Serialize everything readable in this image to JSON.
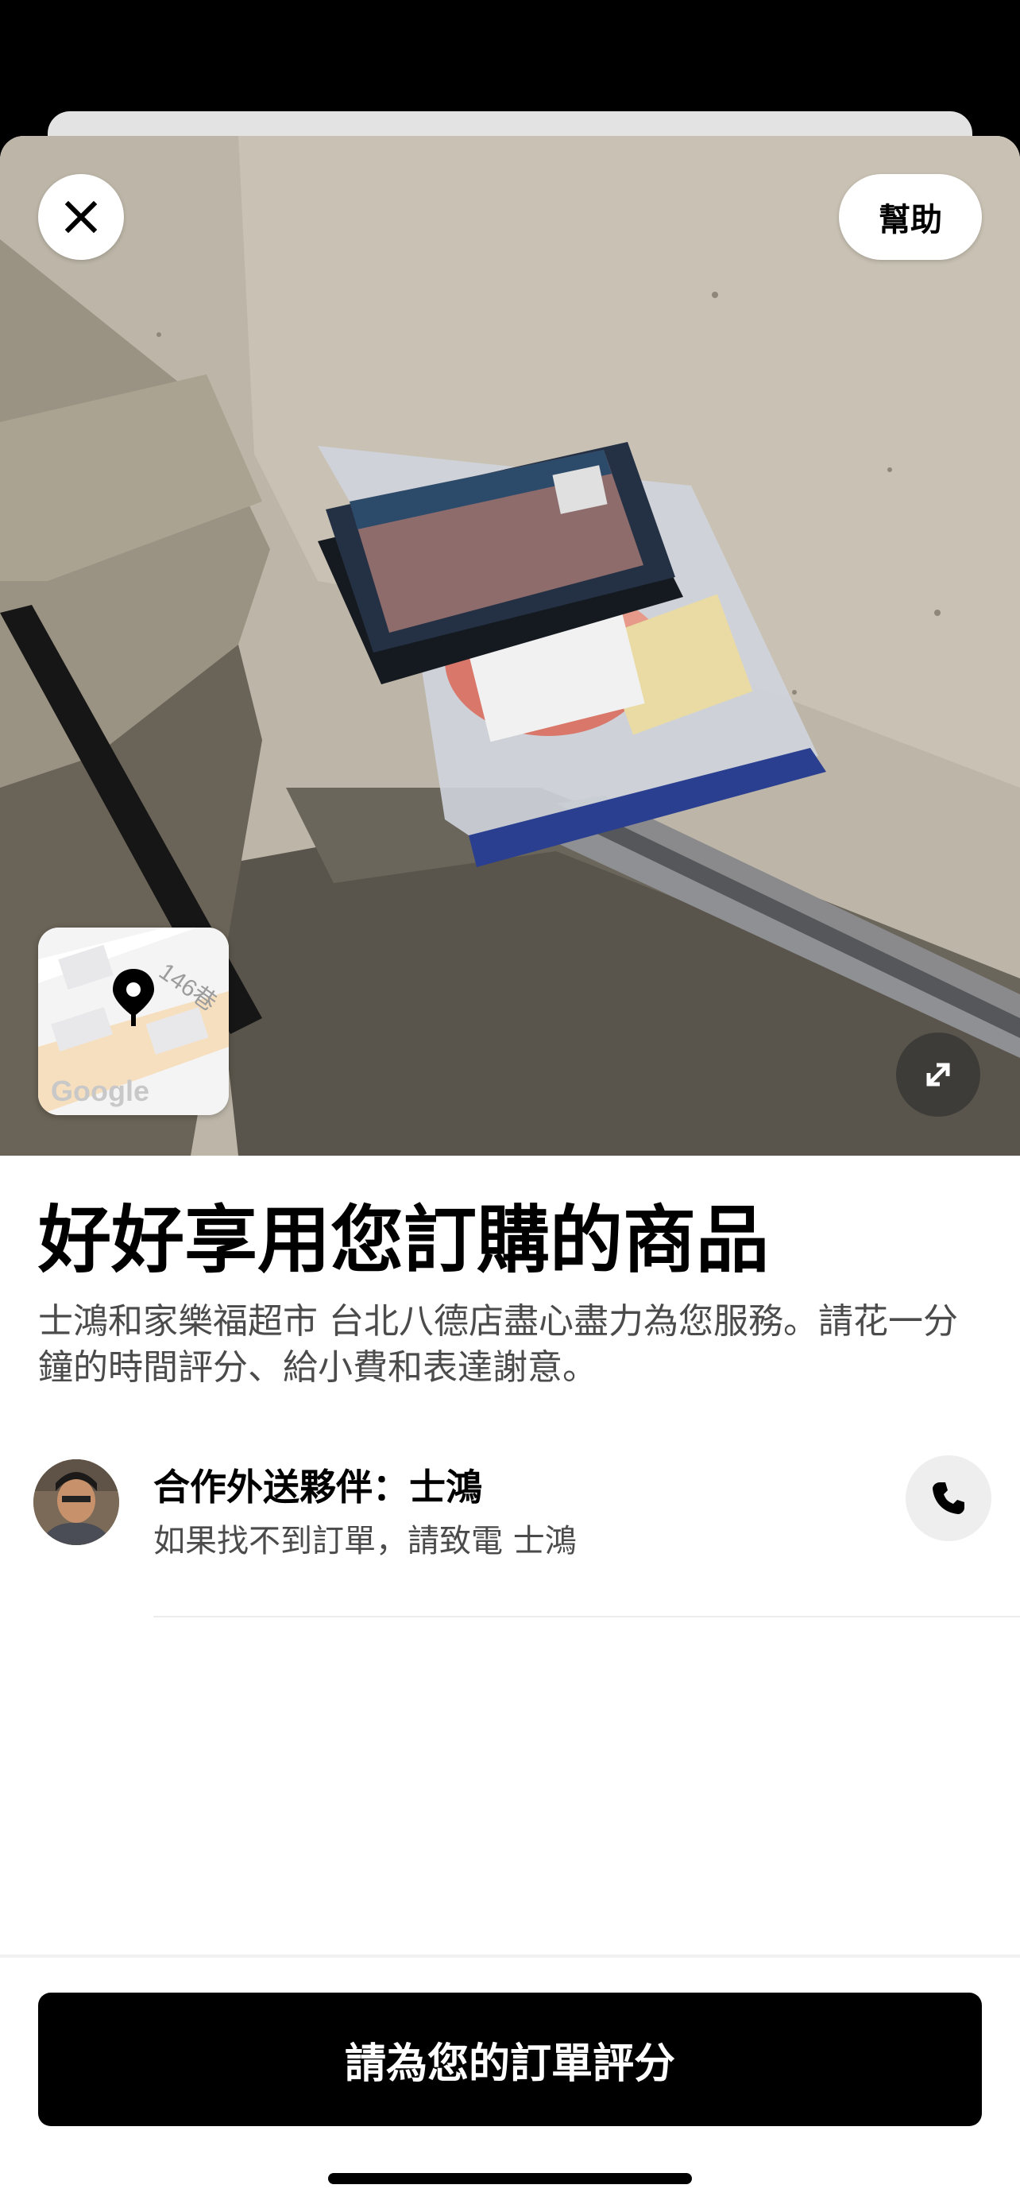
{
  "header": {
    "help_label": "幫助"
  },
  "photo": {
    "map_watermark": "Google",
    "map_street_fragment": "146巷"
  },
  "main": {
    "title": "好好享用您訂購的商品",
    "description": "士鴻和家樂福超市 台北八德店盡心盡力為您服務。請花一分鐘的時間評分、給小費和表達謝意。"
  },
  "courier": {
    "name": "合作外送夥伴：士鴻",
    "hint": "如果找不到訂單，請致電 士鴻"
  },
  "footer": {
    "rate_button_label": "請為您的訂單評分"
  },
  "icons": {
    "close": "close-icon",
    "expand": "expand-icon",
    "phone": "phone-icon",
    "map_pin": "map-pin-icon"
  }
}
